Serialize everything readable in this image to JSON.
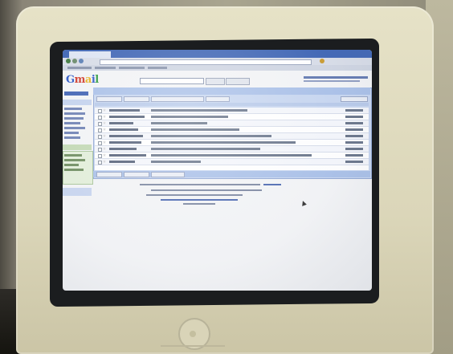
{
  "scene": {
    "monitor_brand": "",
    "monitor_model_label": "",
    "colors": {
      "bezel": "#dbd6b9",
      "screen": "#f3f4f6",
      "browser_chrome": "#3d64b4",
      "gmail_panel": "#c7d6f0"
    }
  },
  "screen": {
    "logo": [
      "G",
      "m",
      "a",
      "i",
      "l"
    ],
    "icons": [
      "back-arrow-icon",
      "forward-arrow-icon",
      "reload-icon",
      "star-icon",
      "mouse-cursor-icon",
      "power-button-icon"
    ]
  }
}
